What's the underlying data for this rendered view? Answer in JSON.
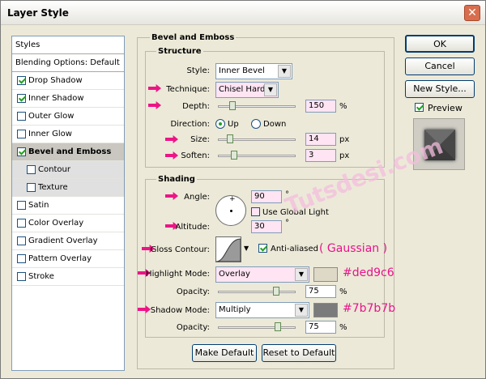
{
  "window": {
    "title": "Layer Style",
    "close_glyph": "✕"
  },
  "left_panel": {
    "header": "Styles",
    "blending": "Blending Options: Default",
    "items": [
      {
        "label": "Drop Shadow",
        "checked": true
      },
      {
        "label": "Inner Shadow",
        "checked": true
      },
      {
        "label": "Outer Glow",
        "checked": false
      },
      {
        "label": "Inner Glow",
        "checked": false
      },
      {
        "label": "Bevel and Emboss",
        "checked": true,
        "selected": true
      },
      {
        "label": "Contour",
        "checked": false,
        "sub": true
      },
      {
        "label": "Texture",
        "checked": false,
        "sub": true
      },
      {
        "label": "Satin",
        "checked": false
      },
      {
        "label": "Color Overlay",
        "checked": false
      },
      {
        "label": "Gradient Overlay",
        "checked": false
      },
      {
        "label": "Pattern Overlay",
        "checked": false
      },
      {
        "label": "Stroke",
        "checked": false
      }
    ]
  },
  "bevel": {
    "section_title": "Bevel and Emboss",
    "structure_title": "Structure",
    "style_label": "Style:",
    "style_value": "Inner Bevel",
    "technique_label": "Technique:",
    "technique_value": "Chisel Hard",
    "depth_label": "Depth:",
    "depth_value": "150",
    "depth_unit": "%",
    "direction_label": "Direction:",
    "direction_up": "Up",
    "direction_down": "Down",
    "size_label": "Size:",
    "size_value": "14",
    "size_unit": "px",
    "soften_label": "Soften:",
    "soften_value": "3",
    "soften_unit": "px"
  },
  "shading": {
    "title": "Shading",
    "angle_label": "Angle:",
    "angle_value": "90",
    "angle_unit": "°",
    "global_light_label": "Use Global Light",
    "altitude_label": "Altitude:",
    "altitude_value": "30",
    "altitude_unit": "°",
    "gloss_label": "Gloss Contour:",
    "anti_aliased_label": "Anti-aliased",
    "gloss_note": "( Gaussian )",
    "highlight_mode_label": "Highlight Mode:",
    "highlight_mode_value": "Overlay",
    "highlight_color_text": "#ded9c6",
    "highlight_color": "#ded9c6",
    "highlight_opacity_label": "Opacity:",
    "highlight_opacity_value": "75",
    "opacity_unit": "%",
    "shadow_mode_label": "Shadow Mode:",
    "shadow_mode_value": "Multiply",
    "shadow_color_text": "#7b7b7b",
    "shadow_color": "#7b7b7b",
    "shadow_opacity_label": "Opacity:",
    "shadow_opacity_value": "75"
  },
  "buttons": {
    "ok": "OK",
    "cancel": "Cancel",
    "new_style": "New Style...",
    "preview": "Preview",
    "make_default": "Make Default",
    "reset_default": "Reset to Default"
  },
  "watermark": "Tutsdesi.com",
  "accent": "#ec1586"
}
